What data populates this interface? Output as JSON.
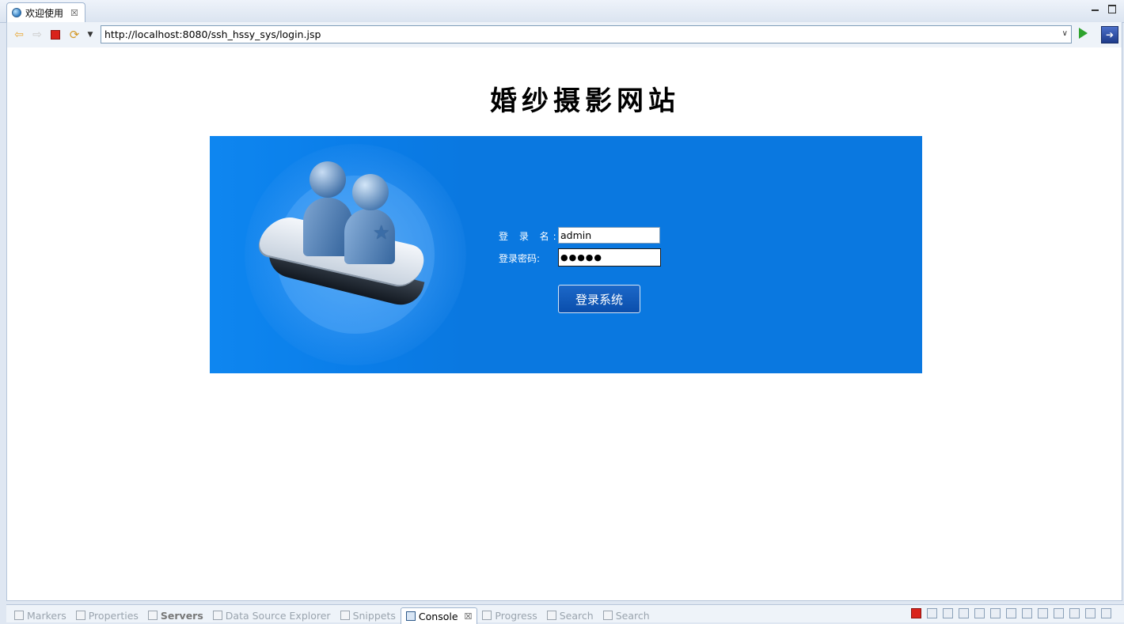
{
  "editor_tab": {
    "title": "欢迎使用",
    "close": "☒"
  },
  "toolbar": {
    "url": "http://localhost:8080/ssh_hssy_sys/login.jsp"
  },
  "page": {
    "site_title": "婚纱摄影网站",
    "form": {
      "username_label": "登 录 名:",
      "username_value": "admin",
      "password_label": "登录密码:",
      "password_mask": "●●●●●",
      "submit_label": "登录系统"
    }
  },
  "bottom_tabs": [
    {
      "label": "Markers"
    },
    {
      "label": "Properties"
    },
    {
      "label": "Servers"
    },
    {
      "label": "Data Source Explorer"
    },
    {
      "label": "Snippets"
    },
    {
      "label": "Console"
    },
    {
      "label": "Progress"
    },
    {
      "label": "Search"
    },
    {
      "label": "Search"
    }
  ],
  "colors": {
    "panel_blue": "#0a78e0",
    "button_blue": "#0a4eac"
  }
}
